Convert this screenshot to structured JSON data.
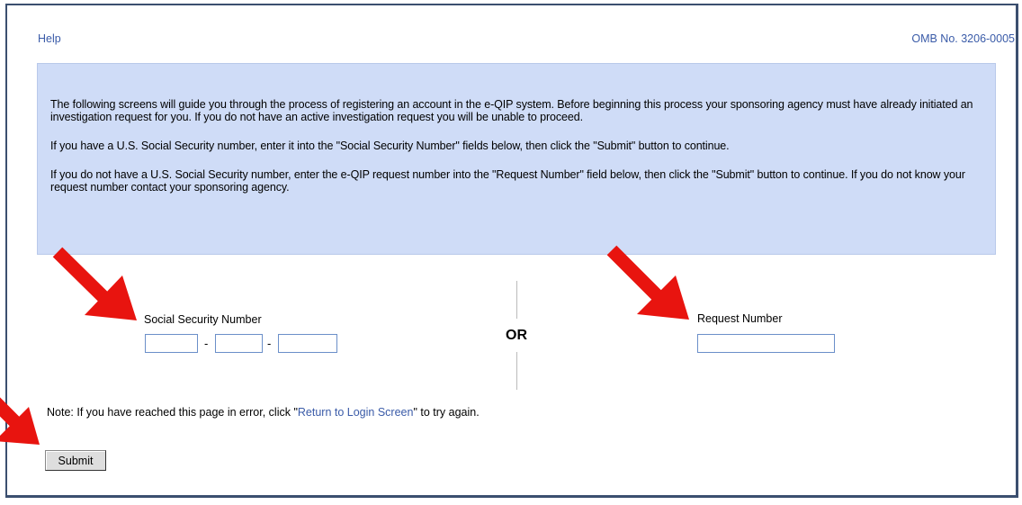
{
  "header": {
    "help_label": "Help",
    "omb_number": "OMB No. 3206-0005"
  },
  "info_box": {
    "paragraph_1": "The following screens will guide you through the process of registering an account in the e-QIP system. Before beginning this process your sponsoring agency must have already initiated an investigation request for you. If you do not have an active investigation request you will be unable to proceed.",
    "paragraph_2": "If you have a U.S. Social Security number, enter it into the \"Social Security Number\" fields below, then click the \"Submit\" button to continue.",
    "paragraph_3": "If you do not have a U.S. Social Security number, enter the e-QIP request number into the \"Request Number\" field below, then click the \"Submit\" button to continue. If you do not know your request number contact your sponsoring agency."
  },
  "form": {
    "ssn_label": "Social Security Number",
    "ssn_separator": "-",
    "or_label": "OR",
    "request_label": "Request Number",
    "ssn_part1_value": "",
    "ssn_part2_value": "",
    "ssn_part3_value": "",
    "request_value": ""
  },
  "note": {
    "prefix": "Note: If you have reached this page in error, click \"",
    "link_text": "Return to Login Screen",
    "suffix": "\" to try again."
  },
  "submit_label": "Submit",
  "colors": {
    "accent_link": "#3a5ba8",
    "info_background": "#cfdcf7",
    "arrow_red": "#e8140f"
  }
}
